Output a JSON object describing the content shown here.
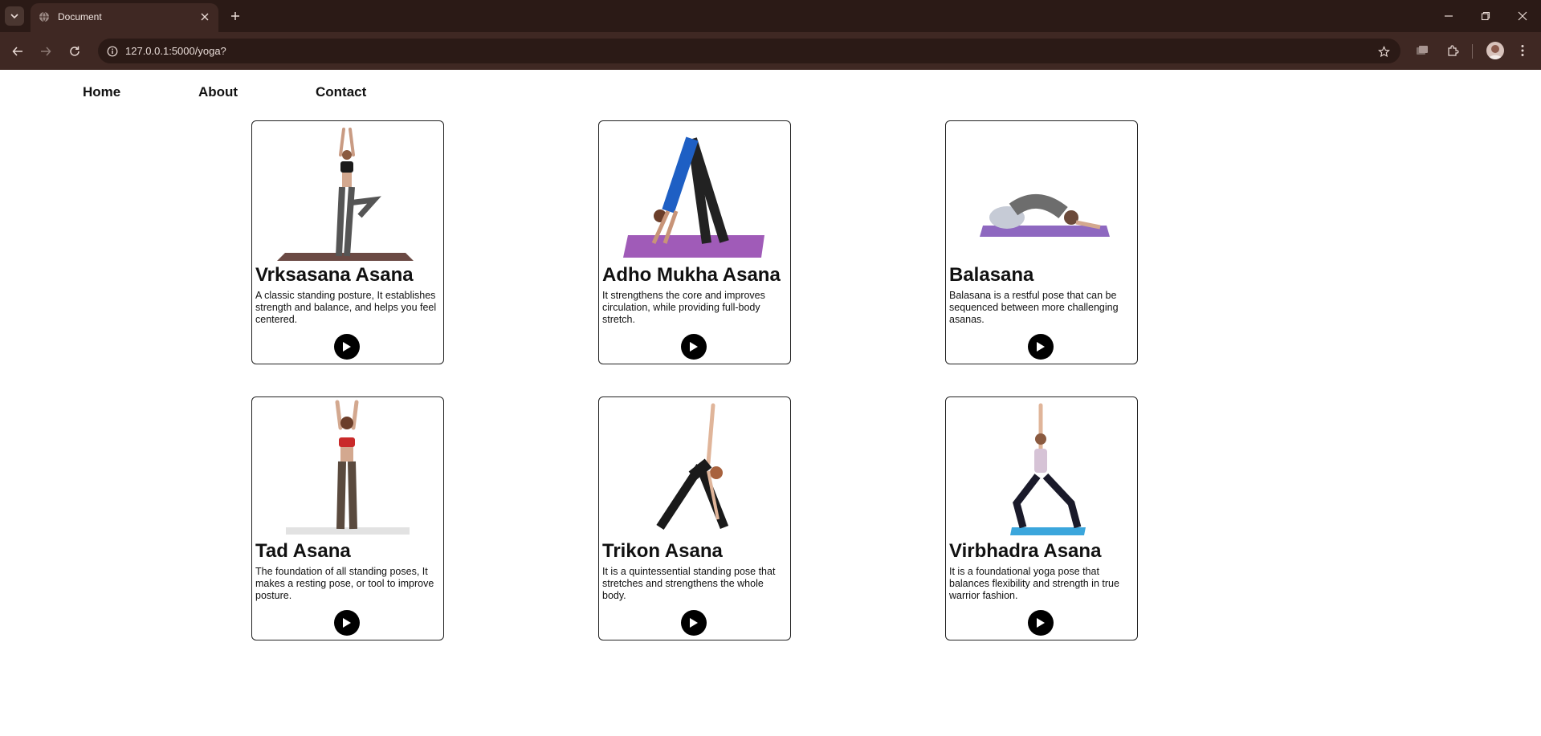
{
  "browser": {
    "tab_title": "Document",
    "url": "127.0.0.1:5000/yoga?"
  },
  "nav": {
    "links": [
      "Home",
      "About",
      "Contact"
    ]
  },
  "cards": [
    {
      "title": "Vrksasana Asana",
      "description": "A classic standing posture, It establishes strength and balance, and helps you feel centered."
    },
    {
      "title": "Adho Mukha Asana",
      "description": "It strengthens the core and improves circulation, while providing full-body stretch."
    },
    {
      "title": "Balasana",
      "description": "Balasana is a restful pose that can be sequenced between more challenging asanas."
    },
    {
      "title": "Tad Asana",
      "description": "The foundation of all standing poses, It makes a resting pose, or tool to improve posture."
    },
    {
      "title": "Trikon Asana",
      "description": "It is a quintessential standing pose that stretches and strengthens the whole body."
    },
    {
      "title": "Virbhadra Asana",
      "description": "It is a foundational yoga pose that balances flexibility and strength in true warrior fashion."
    }
  ],
  "colors": {
    "browser_frame": "#2b1a16",
    "browser_toolbar": "#3f2823",
    "card_border": "#222222",
    "play_button": "#000000"
  },
  "icons": {
    "play": "play-icon"
  }
}
